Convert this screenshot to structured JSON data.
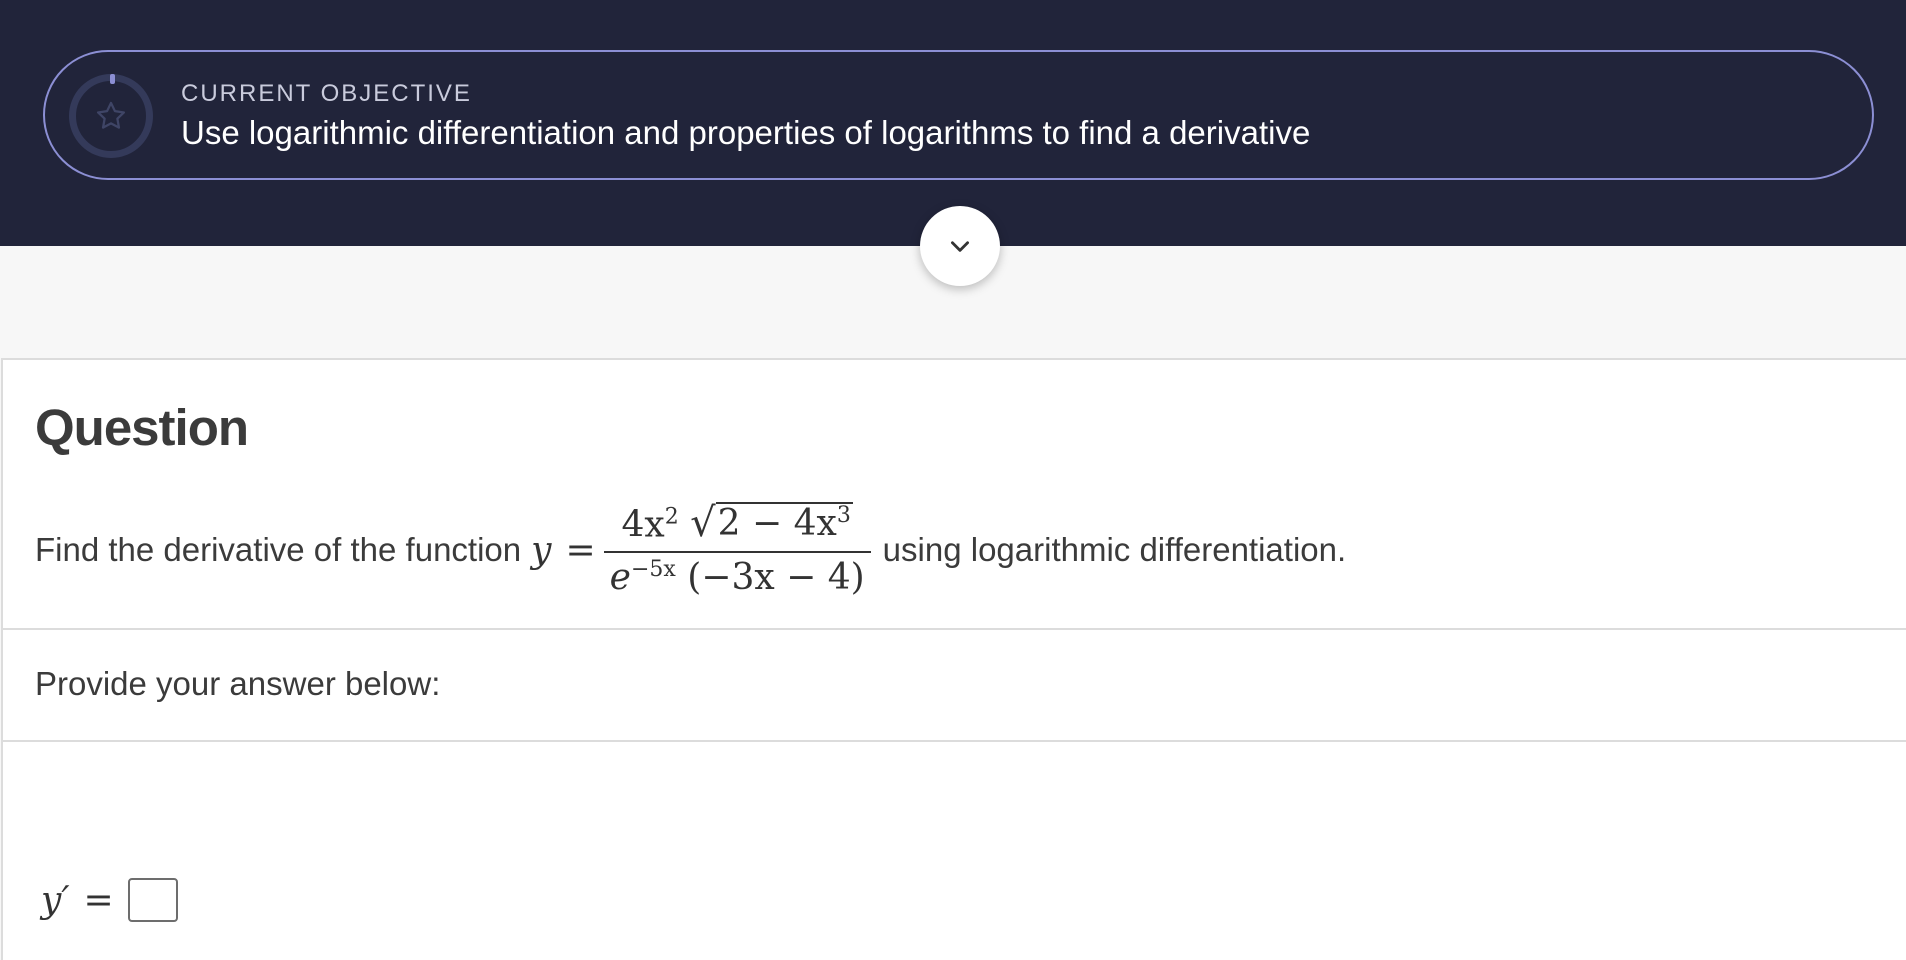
{
  "objective": {
    "label": "CURRENT OBJECTIVE",
    "text": "Use logarithmic differentiation and properties of logarithms to find a derivative",
    "icon": "star-icon"
  },
  "toggle": {
    "icon": "chevron-down-icon"
  },
  "question": {
    "title": "Question",
    "prompt_before": "Find the derivative of the function",
    "function_var": "y",
    "equals": "=",
    "numerator_coef": "4x",
    "numerator_exp": "2",
    "radicand_base": "2 − 4x",
    "radicand_exp": "3",
    "denominator_base": "e",
    "denominator_exp": "−5x",
    "denominator_factor": "(−3x − 4)",
    "prompt_after": "using logarithmic differentiation."
  },
  "answer": {
    "label": "Provide your answer below:",
    "lhs": "y′",
    "equals": "="
  },
  "colors": {
    "header_bg": "#21243a",
    "pill_border": "#8c8fd4",
    "page_bg": "#f7f7f7"
  }
}
